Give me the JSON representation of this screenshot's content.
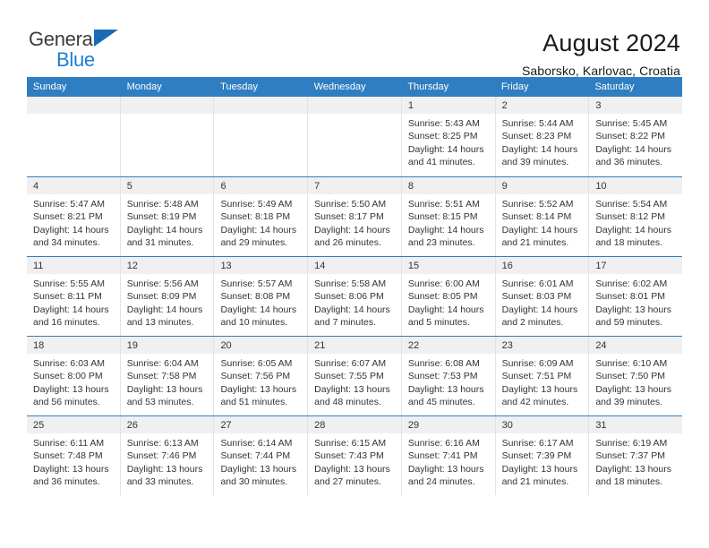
{
  "brand": {
    "name_top": "General",
    "name_bottom": "Blue",
    "triangle_color": "#1a6bb5",
    "blue_color": "#1a7fd4"
  },
  "header": {
    "title": "August 2024",
    "subtitle": "Saborsko, Karlovac, Croatia"
  },
  "theme": {
    "header_bar_color": "#2f7ec1",
    "daynum_band_color": "#f0f0f0",
    "text_color": "#333333",
    "grid_line_color": "#e3e3e3"
  },
  "weekdays": [
    "Sunday",
    "Monday",
    "Tuesday",
    "Wednesday",
    "Thursday",
    "Friday",
    "Saturday"
  ],
  "weeks": [
    [
      {
        "day": "",
        "empty": true
      },
      {
        "day": "",
        "empty": true
      },
      {
        "day": "",
        "empty": true
      },
      {
        "day": "",
        "empty": true
      },
      {
        "day": "1",
        "sunrise": "Sunrise: 5:43 AM",
        "sunset": "Sunset: 8:25 PM",
        "daylight1": "Daylight: 14 hours",
        "daylight2": "and 41 minutes."
      },
      {
        "day": "2",
        "sunrise": "Sunrise: 5:44 AM",
        "sunset": "Sunset: 8:23 PM",
        "daylight1": "Daylight: 14 hours",
        "daylight2": "and 39 minutes."
      },
      {
        "day": "3",
        "sunrise": "Sunrise: 5:45 AM",
        "sunset": "Sunset: 8:22 PM",
        "daylight1": "Daylight: 14 hours",
        "daylight2": "and 36 minutes."
      }
    ],
    [
      {
        "day": "4",
        "sunrise": "Sunrise: 5:47 AM",
        "sunset": "Sunset: 8:21 PM",
        "daylight1": "Daylight: 14 hours",
        "daylight2": "and 34 minutes."
      },
      {
        "day": "5",
        "sunrise": "Sunrise: 5:48 AM",
        "sunset": "Sunset: 8:19 PM",
        "daylight1": "Daylight: 14 hours",
        "daylight2": "and 31 minutes."
      },
      {
        "day": "6",
        "sunrise": "Sunrise: 5:49 AM",
        "sunset": "Sunset: 8:18 PM",
        "daylight1": "Daylight: 14 hours",
        "daylight2": "and 29 minutes."
      },
      {
        "day": "7",
        "sunrise": "Sunrise: 5:50 AM",
        "sunset": "Sunset: 8:17 PM",
        "daylight1": "Daylight: 14 hours",
        "daylight2": "and 26 minutes."
      },
      {
        "day": "8",
        "sunrise": "Sunrise: 5:51 AM",
        "sunset": "Sunset: 8:15 PM",
        "daylight1": "Daylight: 14 hours",
        "daylight2": "and 23 minutes."
      },
      {
        "day": "9",
        "sunrise": "Sunrise: 5:52 AM",
        "sunset": "Sunset: 8:14 PM",
        "daylight1": "Daylight: 14 hours",
        "daylight2": "and 21 minutes."
      },
      {
        "day": "10",
        "sunrise": "Sunrise: 5:54 AM",
        "sunset": "Sunset: 8:12 PM",
        "daylight1": "Daylight: 14 hours",
        "daylight2": "and 18 minutes."
      }
    ],
    [
      {
        "day": "11",
        "sunrise": "Sunrise: 5:55 AM",
        "sunset": "Sunset: 8:11 PM",
        "daylight1": "Daylight: 14 hours",
        "daylight2": "and 16 minutes."
      },
      {
        "day": "12",
        "sunrise": "Sunrise: 5:56 AM",
        "sunset": "Sunset: 8:09 PM",
        "daylight1": "Daylight: 14 hours",
        "daylight2": "and 13 minutes."
      },
      {
        "day": "13",
        "sunrise": "Sunrise: 5:57 AM",
        "sunset": "Sunset: 8:08 PM",
        "daylight1": "Daylight: 14 hours",
        "daylight2": "and 10 minutes."
      },
      {
        "day": "14",
        "sunrise": "Sunrise: 5:58 AM",
        "sunset": "Sunset: 8:06 PM",
        "daylight1": "Daylight: 14 hours",
        "daylight2": "and 7 minutes."
      },
      {
        "day": "15",
        "sunrise": "Sunrise: 6:00 AM",
        "sunset": "Sunset: 8:05 PM",
        "daylight1": "Daylight: 14 hours",
        "daylight2": "and 5 minutes."
      },
      {
        "day": "16",
        "sunrise": "Sunrise: 6:01 AM",
        "sunset": "Sunset: 8:03 PM",
        "daylight1": "Daylight: 14 hours",
        "daylight2": "and 2 minutes."
      },
      {
        "day": "17",
        "sunrise": "Sunrise: 6:02 AM",
        "sunset": "Sunset: 8:01 PM",
        "daylight1": "Daylight: 13 hours",
        "daylight2": "and 59 minutes."
      }
    ],
    [
      {
        "day": "18",
        "sunrise": "Sunrise: 6:03 AM",
        "sunset": "Sunset: 8:00 PM",
        "daylight1": "Daylight: 13 hours",
        "daylight2": "and 56 minutes."
      },
      {
        "day": "19",
        "sunrise": "Sunrise: 6:04 AM",
        "sunset": "Sunset: 7:58 PM",
        "daylight1": "Daylight: 13 hours",
        "daylight2": "and 53 minutes."
      },
      {
        "day": "20",
        "sunrise": "Sunrise: 6:05 AM",
        "sunset": "Sunset: 7:56 PM",
        "daylight1": "Daylight: 13 hours",
        "daylight2": "and 51 minutes."
      },
      {
        "day": "21",
        "sunrise": "Sunrise: 6:07 AM",
        "sunset": "Sunset: 7:55 PM",
        "daylight1": "Daylight: 13 hours",
        "daylight2": "and 48 minutes."
      },
      {
        "day": "22",
        "sunrise": "Sunrise: 6:08 AM",
        "sunset": "Sunset: 7:53 PM",
        "daylight1": "Daylight: 13 hours",
        "daylight2": "and 45 minutes."
      },
      {
        "day": "23",
        "sunrise": "Sunrise: 6:09 AM",
        "sunset": "Sunset: 7:51 PM",
        "daylight1": "Daylight: 13 hours",
        "daylight2": "and 42 minutes."
      },
      {
        "day": "24",
        "sunrise": "Sunrise: 6:10 AM",
        "sunset": "Sunset: 7:50 PM",
        "daylight1": "Daylight: 13 hours",
        "daylight2": "and 39 minutes."
      }
    ],
    [
      {
        "day": "25",
        "sunrise": "Sunrise: 6:11 AM",
        "sunset": "Sunset: 7:48 PM",
        "daylight1": "Daylight: 13 hours",
        "daylight2": "and 36 minutes."
      },
      {
        "day": "26",
        "sunrise": "Sunrise: 6:13 AM",
        "sunset": "Sunset: 7:46 PM",
        "daylight1": "Daylight: 13 hours",
        "daylight2": "and 33 minutes."
      },
      {
        "day": "27",
        "sunrise": "Sunrise: 6:14 AM",
        "sunset": "Sunset: 7:44 PM",
        "daylight1": "Daylight: 13 hours",
        "daylight2": "and 30 minutes."
      },
      {
        "day": "28",
        "sunrise": "Sunrise: 6:15 AM",
        "sunset": "Sunset: 7:43 PM",
        "daylight1": "Daylight: 13 hours",
        "daylight2": "and 27 minutes."
      },
      {
        "day": "29",
        "sunrise": "Sunrise: 6:16 AM",
        "sunset": "Sunset: 7:41 PM",
        "daylight1": "Daylight: 13 hours",
        "daylight2": "and 24 minutes."
      },
      {
        "day": "30",
        "sunrise": "Sunrise: 6:17 AM",
        "sunset": "Sunset: 7:39 PM",
        "daylight1": "Daylight: 13 hours",
        "daylight2": "and 21 minutes."
      },
      {
        "day": "31",
        "sunrise": "Sunrise: 6:19 AM",
        "sunset": "Sunset: 7:37 PM",
        "daylight1": "Daylight: 13 hours",
        "daylight2": "and 18 minutes."
      }
    ]
  ]
}
